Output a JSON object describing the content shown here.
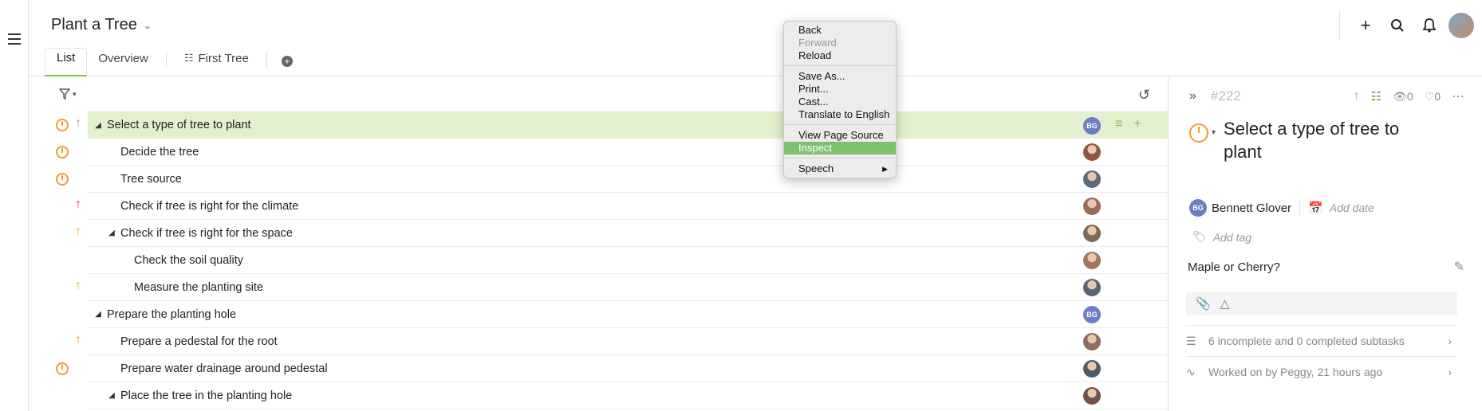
{
  "header": {
    "project_title": "Plant a Tree",
    "tabs": [
      {
        "label": "List",
        "active": true
      },
      {
        "label": "Overview",
        "active": false
      },
      {
        "label": "First Tree",
        "active": false
      }
    ],
    "icons": [
      "plus-icon",
      "search-icon",
      "bell-icon",
      "user-avatar"
    ]
  },
  "tasks": [
    {
      "title": "Select a type of tree to plant",
      "level": 0,
      "expander": true,
      "status": "in-progress",
      "priority": "up-gray",
      "assignee": "BG",
      "selected": true
    },
    {
      "title": "Decide the tree",
      "level": 1,
      "expander": false,
      "status": "in-progress",
      "priority": "",
      "assignee": "photo"
    },
    {
      "title": "Tree source",
      "level": 1,
      "expander": false,
      "status": "in-progress",
      "priority": "",
      "assignee": "photo"
    },
    {
      "title": "Check if tree is right for the climate",
      "level": 1,
      "expander": false,
      "status": "",
      "priority": "up-red",
      "assignee": "photo"
    },
    {
      "title": "Check if tree is right for the space",
      "level": 1,
      "expander": true,
      "status": "",
      "priority": "up-orange",
      "assignee": "photo"
    },
    {
      "title": "Check the soil quality",
      "level": 2,
      "expander": false,
      "status": "",
      "priority": "",
      "assignee": "photo"
    },
    {
      "title": "Measure the planting site",
      "level": 2,
      "expander": false,
      "status": "",
      "priority": "up-orange",
      "assignee": "photo"
    },
    {
      "title": "Prepare the planting hole",
      "level": 0,
      "expander": true,
      "status": "",
      "priority": "",
      "assignee": "BG"
    },
    {
      "title": "Prepare a pedestal for the root",
      "level": 1,
      "expander": false,
      "status": "",
      "priority": "up-orange",
      "assignee": "photo"
    },
    {
      "title": "Prepare water drainage around pedestal",
      "level": 1,
      "expander": false,
      "status": "in-progress",
      "priority": "",
      "assignee": "photo"
    },
    {
      "title": "Place the tree in the planting hole",
      "level": 1,
      "expander": true,
      "status": "",
      "priority": "",
      "assignee": "photo"
    }
  ],
  "detail": {
    "number": "#222",
    "watchers": "0",
    "likes": "0",
    "title": "Select a type of tree to plant",
    "assignee_initials": "BG",
    "assignee_name": "Bennett Glover",
    "add_date": "Add date",
    "add_tag": "Add tag",
    "description": "Maple or Cherry?",
    "subtasks": "6 incomplete and 0 completed subtasks",
    "worked_on": "Worked on by Peggy, 21 hours ago"
  },
  "context_menu": {
    "items": [
      "Back",
      "Forward",
      "Reload",
      "Save As...",
      "Print...",
      "Cast...",
      "Translate to English",
      "View Page Source",
      "Inspect",
      "Speech"
    ],
    "disabled": [
      "Forward"
    ],
    "highlighted": "Inspect"
  },
  "colors": {
    "accent_green": "#8bc34a",
    "selected_row": "#e2f0cd",
    "status_orange": "#f39c34",
    "priority_red": "#e53935",
    "priority_orange": "#f5a623",
    "badge_blue": "#6b7fc2"
  }
}
